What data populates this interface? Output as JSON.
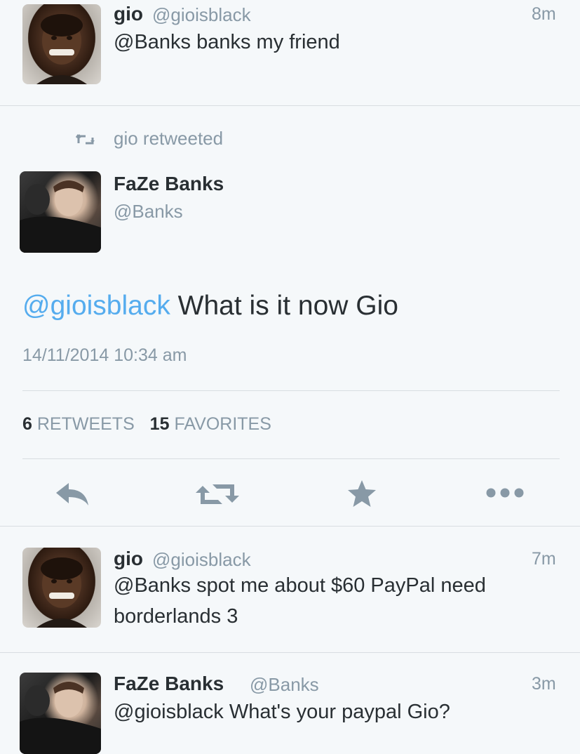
{
  "tweet1": {
    "name": "gio",
    "handle": "@gioisblack",
    "time": "8m",
    "text": "@Banks banks my friend"
  },
  "retweet_context": {
    "label": "gio retweeted"
  },
  "main_tweet": {
    "name": "FaZe Banks",
    "handle": "@Banks",
    "mention": "@gioisblack",
    "text": " What is it now Gio",
    "timestamp": "14/11/2014 10:34 am",
    "retweets_count": "6",
    "retweets_label": "RETWEETS",
    "favorites_count": "15",
    "favorites_label": "FAVORITES",
    "actions": {
      "reply_icon": "reply-icon",
      "retweet_icon": "retweet-icon",
      "favorite_icon": "star-icon",
      "more_icon": "more-icon"
    }
  },
  "tweet2": {
    "name": "gio",
    "handle": "@gioisblack",
    "time": "7m",
    "text_line1": "@Banks spot me about $60 PayPal need",
    "text_line2": "borderlands 3"
  },
  "tweet3": {
    "name": "FaZe Banks",
    "handle": "@Banks",
    "time": "3m",
    "text": "@gioisblack What's your paypal Gio?"
  },
  "colors": {
    "background": "#f5f8fa",
    "text": "#292f33",
    "secondary": "#8899a6",
    "link": "#55acee",
    "divider": "#d8dde1"
  }
}
